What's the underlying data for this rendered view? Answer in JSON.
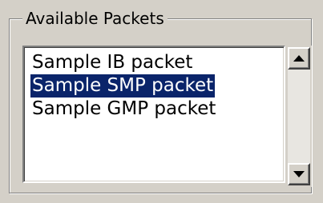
{
  "group": {
    "title": "Available Packets"
  },
  "packets": {
    "items": [
      {
        "label": "Sample IB packet",
        "selected": false
      },
      {
        "label": "Sample SMP packet",
        "selected": true
      },
      {
        "label": "Sample GMP packet",
        "selected": false
      }
    ]
  },
  "colors": {
    "selection": "#0a246a",
    "selection_text": "#ffffff",
    "face": "#d4d0c8"
  },
  "icons": {
    "scroll_up": "triangle-up-icon",
    "scroll_down": "triangle-down-icon"
  }
}
